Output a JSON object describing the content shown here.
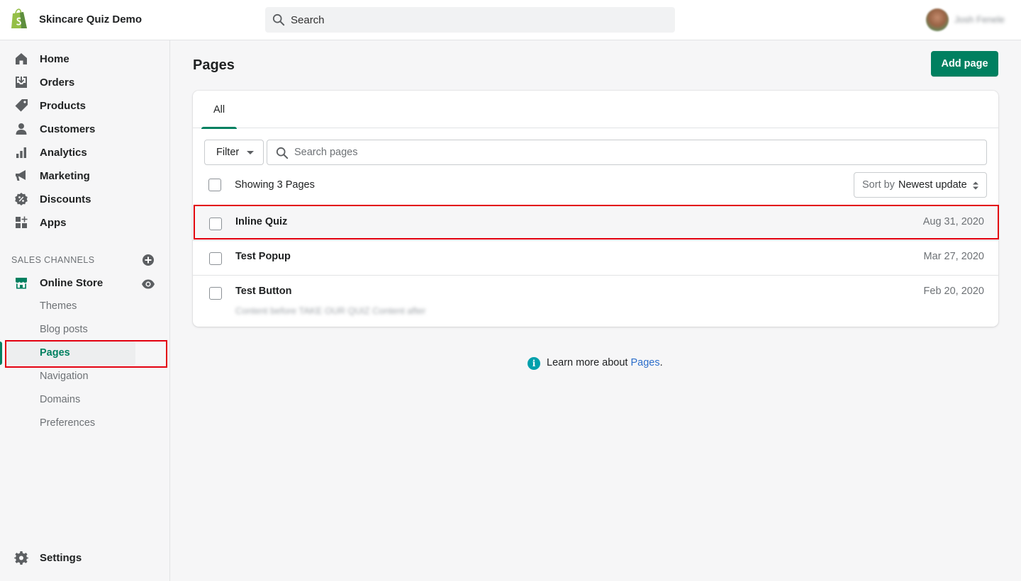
{
  "topbar": {
    "store_name": "Skincare Quiz Demo",
    "search_label": "Search",
    "user_name": "Josh Fenele",
    "logo_icon": "shopify-bag-icon"
  },
  "sidebar": {
    "items": [
      {
        "label": "Home",
        "icon": "home-icon"
      },
      {
        "label": "Orders",
        "icon": "orders-icon"
      },
      {
        "label": "Products",
        "icon": "tag-icon"
      },
      {
        "label": "Customers",
        "icon": "person-icon"
      },
      {
        "label": "Analytics",
        "icon": "bar-chart-icon"
      },
      {
        "label": "Marketing",
        "icon": "megaphone-icon"
      },
      {
        "label": "Discounts",
        "icon": "discount-icon"
      },
      {
        "label": "Apps",
        "icon": "apps-icon"
      }
    ],
    "sales_channels_title": "SALES CHANNELS",
    "online_store": {
      "label": "Online Store",
      "sub_items": [
        "Themes",
        "Blog posts",
        "Pages",
        "Navigation",
        "Domains",
        "Preferences"
      ],
      "active": "Pages"
    },
    "settings_label": "Settings"
  },
  "main": {
    "title": "Pages",
    "add_button": "Add page",
    "tab_all": "All",
    "filter_label": "Filter",
    "search_placeholder": "Search pages",
    "showing": "Showing 3 Pages",
    "sort_by": "Sort by",
    "sort_value": "Newest update",
    "rows": [
      {
        "title": "Inline Quiz",
        "date": "Aug 31, 2020"
      },
      {
        "title": "Test Popup",
        "date": "Mar 27, 2020"
      },
      {
        "title": "Test Button",
        "date": "Feb 20, 2020",
        "excerpt": "Content before TAKE OUR QUIZ Content after"
      }
    ]
  },
  "footer": {
    "learn_prefix": "Learn more about ",
    "learn_link": "Pages",
    "learn_suffix": "."
  },
  "colors": {
    "primary": "#008060",
    "highlight_box": "#e3000f",
    "link": "#2c6ecb",
    "info": "#00a0ac"
  }
}
